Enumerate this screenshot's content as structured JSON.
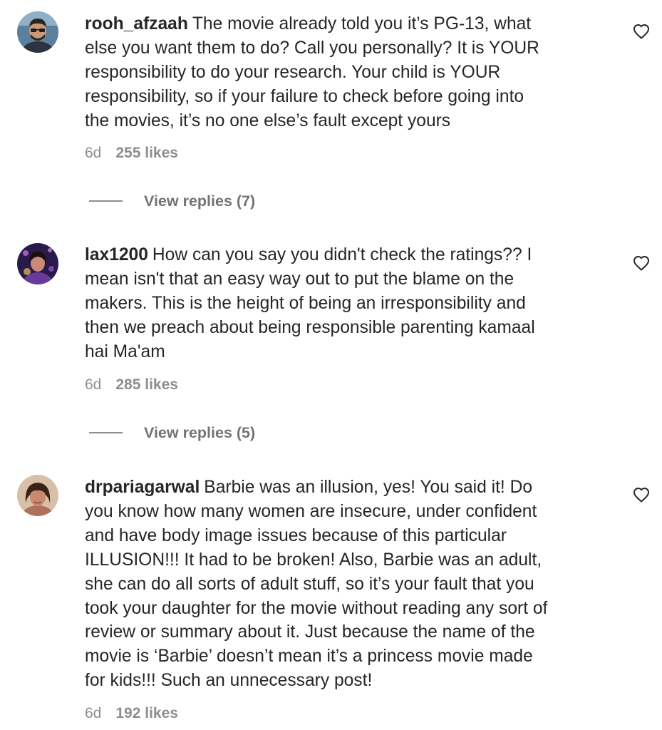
{
  "comments": [
    {
      "username": "rooh_afzaah",
      "lines": [
        "The movie already told you it’s PG-13, what",
        "else you want them to do? Call you personally? It is YOUR",
        "responsibility to do your research. Your child is YOUR",
        "responsibility, so if your failure to check before going into",
        "the movies, it’s no one else’s fault except yours"
      ],
      "time": "6d",
      "likes": "255 likes",
      "view_replies": "View replies (7)",
      "avatar_icon": "user-avatar-icon",
      "like_icon": "heart-outline-icon"
    },
    {
      "username": "lax1200",
      "lines": [
        "How can you say you didn't check the ratings?? I",
        "mean isn't that an easy way out to put the blame on the",
        "makers. This is the height of being an irresponsibility and",
        "then we preach about being responsible parenting kamaal",
        "hai Ma'am"
      ],
      "time": "6d",
      "likes": "285 likes",
      "view_replies": "View replies (5)",
      "avatar_icon": "user-avatar-icon",
      "like_icon": "heart-outline-icon"
    },
    {
      "username": "drpariagarwal",
      "lines": [
        "Barbie was an illusion, yes! You said it! Do",
        "you know how many women are insecure, under confident",
        "and have body image issues because of this particular",
        "ILLUSION!!! It had to be broken! Also, Barbie was an adult,",
        "she can do all sorts of adult stuff, so it’s your fault that you",
        "took your daughter for the movie without reading any sort of",
        "review or summary about it. Just because the name of the",
        "movie is ‘Barbie’ doesn’t mean it’s a princess movie made",
        "for kids!!! Such an unnecessary post!"
      ],
      "time": "6d",
      "likes": "192 likes",
      "avatar_icon": "user-avatar-icon",
      "like_icon": "heart-outline-icon"
    }
  ]
}
